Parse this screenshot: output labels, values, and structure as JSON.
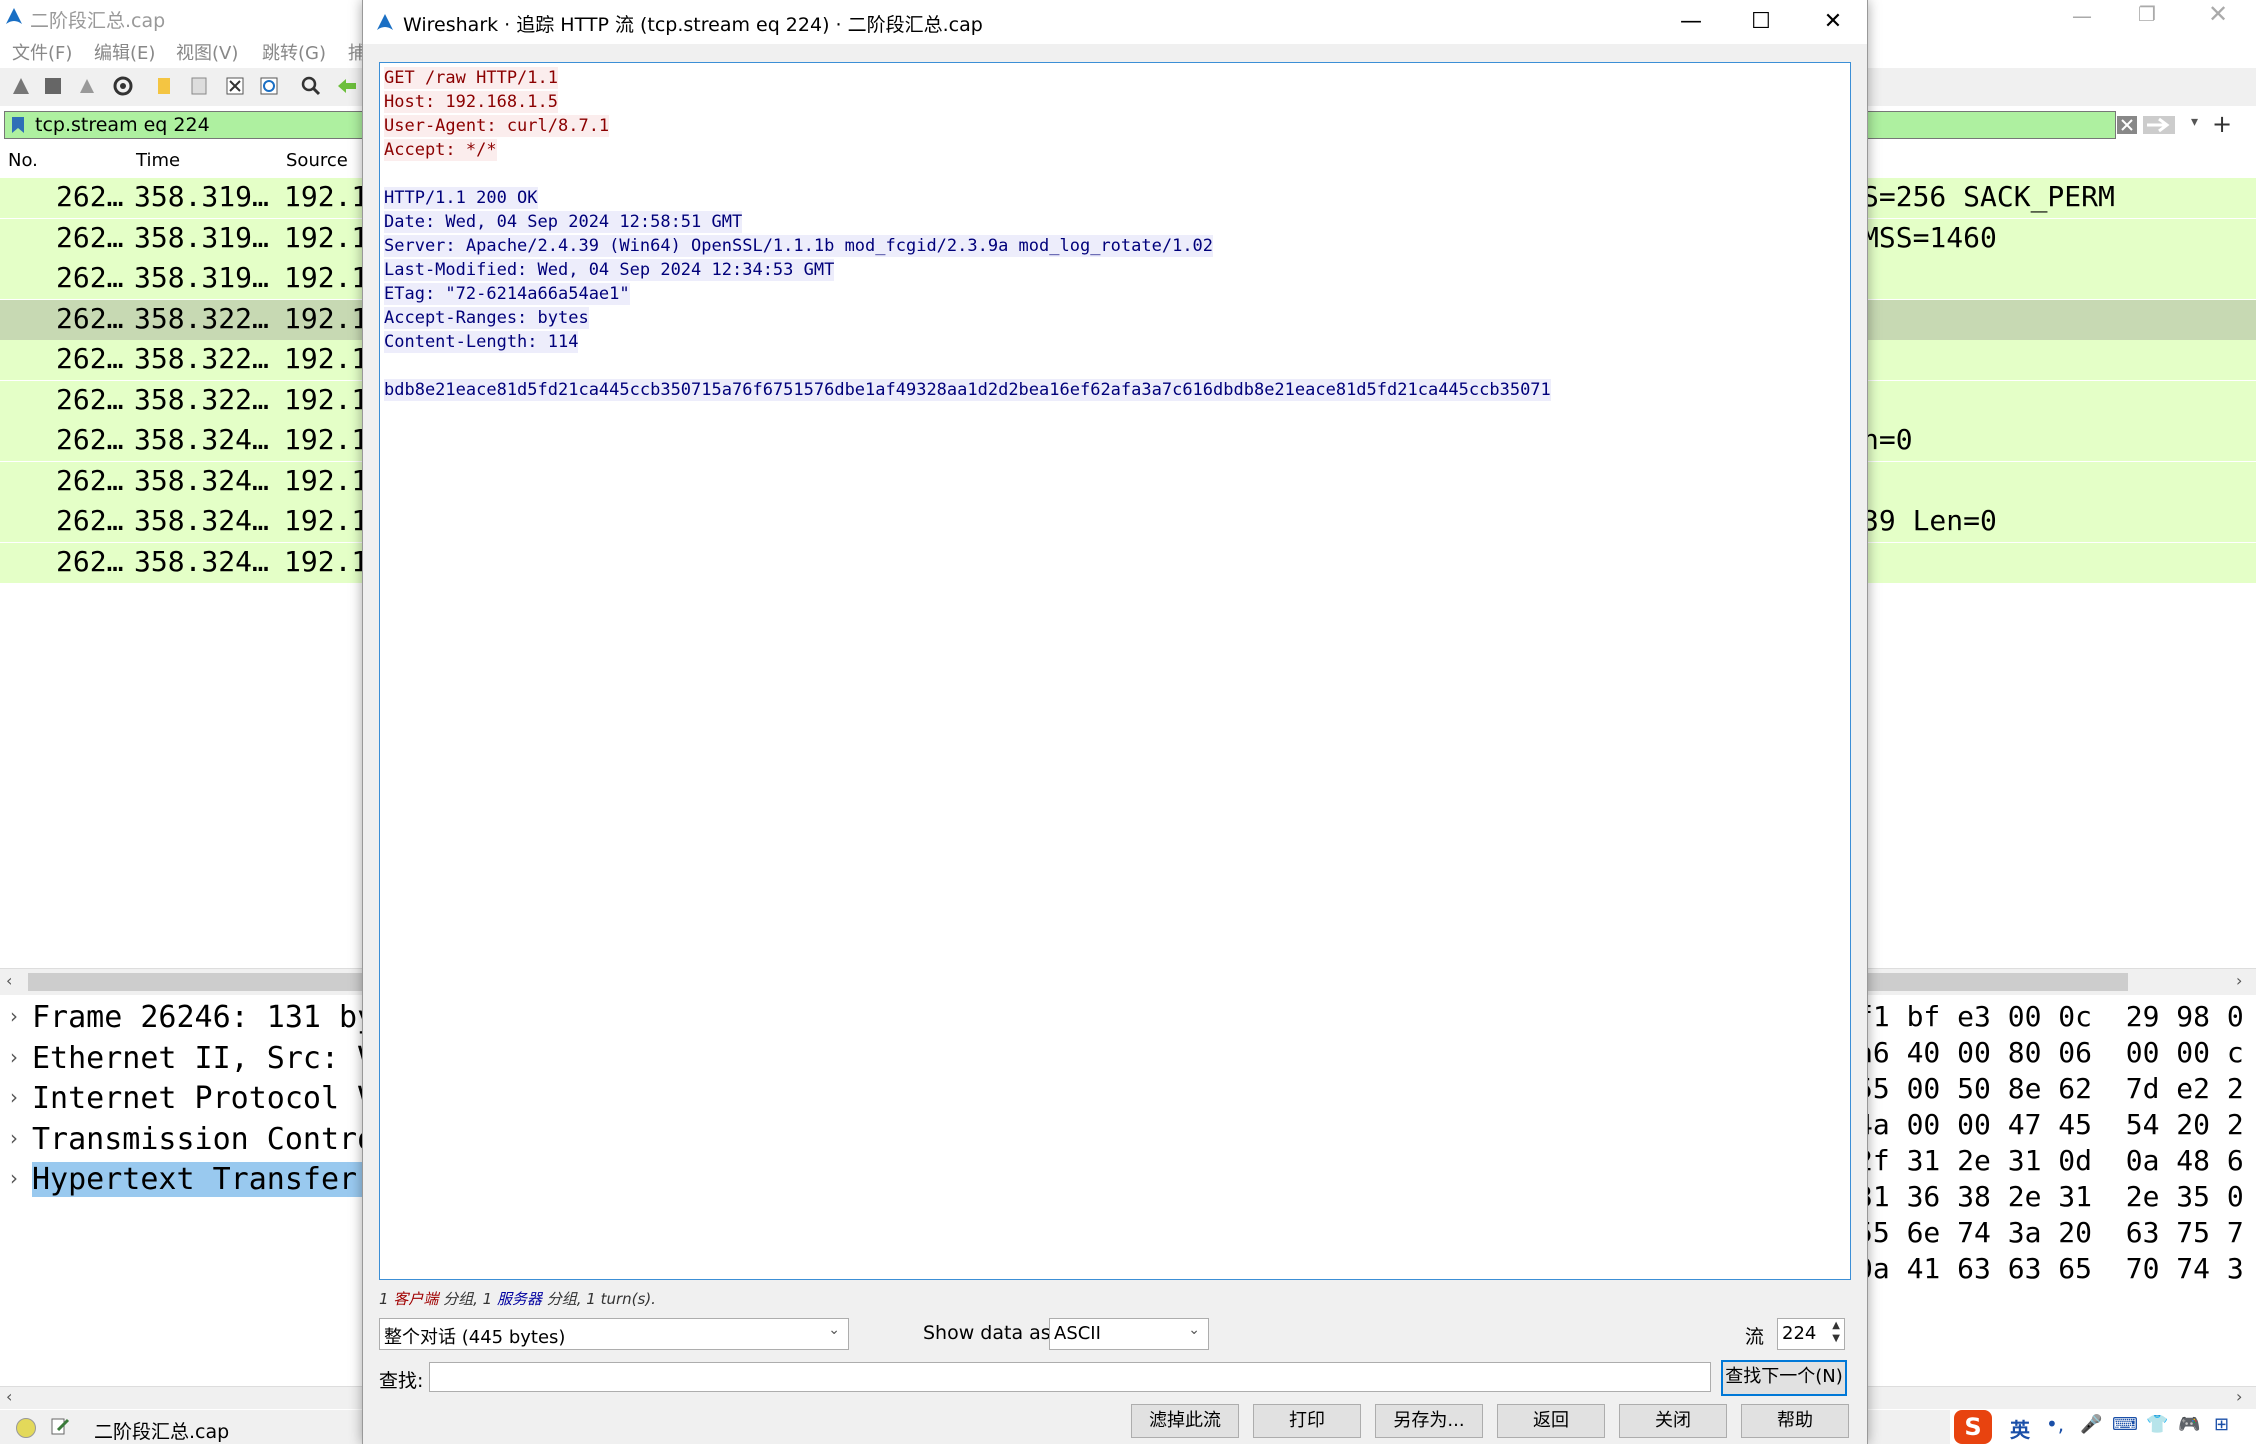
{
  "main": {
    "title": "二阶段汇总.cap",
    "menu": [
      "文件(F)",
      "编辑(E)",
      "视图(V)",
      "跳转(G)",
      "捕"
    ],
    "filter_value": "tcp.stream eq 224",
    "columns": [
      "No.",
      "Time",
      "Source"
    ],
    "rows": [
      {
        "no": "262…",
        "time": "358.319…",
        "src": "192.1",
        "info": "S=256 SACK_PERM"
      },
      {
        "no": "262…",
        "time": "358.319…",
        "src": "192.1",
        "info": " MSS=1460"
      },
      {
        "no": "262…",
        "time": "358.319…",
        "src": "192.1",
        "info": ""
      },
      {
        "no": "262…",
        "time": "358.322…",
        "src": "192.1",
        "info": ""
      },
      {
        "no": "262…",
        "time": "358.322…",
        "src": "192.1",
        "info": ""
      },
      {
        "no": "262…",
        "time": "358.322…",
        "src": "192.1",
        "info": ""
      },
      {
        "no": "262…",
        "time": "358.324…",
        "src": "192.1",
        "info": "n=0"
      },
      {
        "no": "262…",
        "time": "358.324…",
        "src": "192.1",
        "info": ""
      },
      {
        "no": "262…",
        "time": "358.324…",
        "src": "192.1",
        "info": "39 Len=0"
      },
      {
        "no": "262…",
        "time": "358.324…",
        "src": "192.1",
        "info": ""
      }
    ],
    "details": [
      "Frame 26246: 131 by",
      "Ethernet II, Src: V",
      "Internet Protocol V",
      "Transmission Contro",
      "Hypertext Transfer "
    ],
    "hex_lines": [
      "f1 bf e3 00 0c  29 98 0",
      "a6 40 00 80 06  00 00 c",
      "55 00 50 8e 62  7d e2 2",
      "4a 00 00 47 45  54 20 2",
      "2f 31 2e 31 0d  0a 48 6",
      "31 36 38 2e 31  2e 35 0",
      "55 6e 74 3a 20  63 75 7",
      "0a 41 63 63 65  70 74 3"
    ],
    "status_file": "二阶段汇总.cap",
    "ime": [
      "英",
      "•,",
      "🎤",
      "⌨",
      "👕",
      "🎮",
      "⊞"
    ]
  },
  "dialog": {
    "title": "Wireshark · 追踪 HTTP 流 (tcp.stream eq 224) · 二阶段汇总.cap",
    "client_lines": [
      "GET /raw HTTP/1.1",
      "Host: 192.168.1.5",
      "User-Agent: curl/8.7.1",
      "Accept: */*"
    ],
    "server_lines": [
      "HTTP/1.1 200 OK",
      "Date: Wed, 04 Sep 2024 12:58:51 GMT",
      "Server: Apache/2.4.39 (Win64) OpenSSL/1.1.1b mod_fcgid/2.3.9a mod_log_rotate/1.02",
      "Last-Modified: Wed, 04 Sep 2024 12:34:53 GMT",
      "ETag: \"72-6214a66a54ae1\"",
      "Accept-Ranges: bytes",
      "Content-Length: 114"
    ],
    "body_line": "bdb8e21eace81d5fd21ca445ccb350715a76f6751576dbe1af49328aa1d2d2bea16ef62afa3a7c616dbdb8e21eace81d5fd21ca445ccb35071",
    "summary": {
      "p1": "1 ",
      "client": "客户端",
      "p2": " 分组, 1 ",
      "server": "服务器",
      "p3": " 分组, 1 turn(s)."
    },
    "conversation_select": "整个对话 (445 bytes)",
    "show_data_label": "Show data as",
    "show_data_value": "ASCII",
    "stream_label": "流",
    "stream_value": "224",
    "find_label": "查找:",
    "find_value": "",
    "find_next": "查找下一个(N)",
    "buttons": {
      "filter_out": "滤掉此流",
      "print": "打印",
      "save_as": "另存为...",
      "back": "返回",
      "close": "关闭",
      "help": "帮助"
    }
  }
}
